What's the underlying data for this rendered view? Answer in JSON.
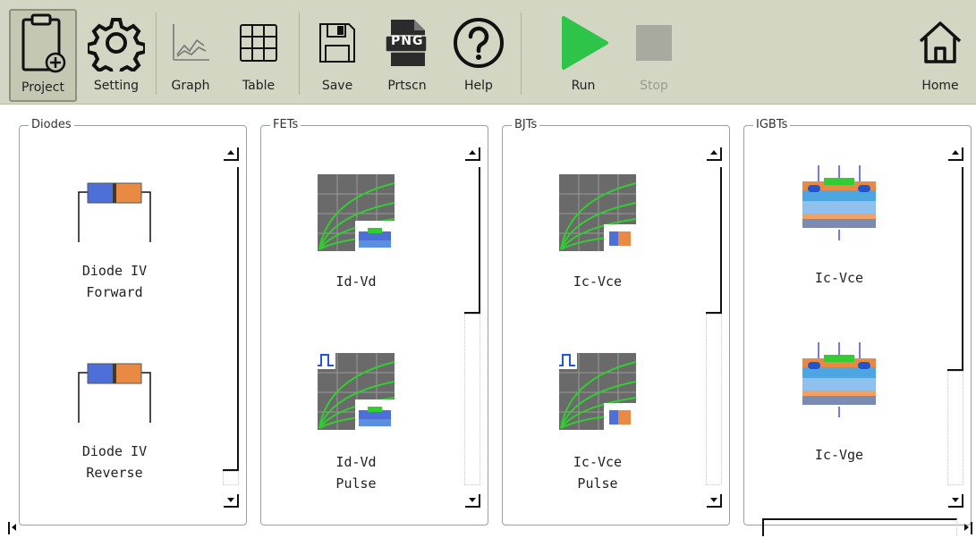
{
  "toolbar": {
    "project": "Project",
    "setting": "Setting",
    "graph": "Graph",
    "table": "Table",
    "save": "Save",
    "prtscn": "Prtscn",
    "png_badge": "PNG",
    "help": "Help",
    "run": "Run",
    "stop": "Stop",
    "home": "Home"
  },
  "groups": {
    "diodes": {
      "title": "Diodes",
      "items": [
        {
          "line1": "Diode IV",
          "line2": "Forward",
          "icon": "diode-icon"
        },
        {
          "line1": "Diode IV",
          "line2": "Reverse",
          "icon": "diode-icon"
        }
      ],
      "scroll_position": 0.0
    },
    "fets": {
      "title": "FETs",
      "items": [
        {
          "line1": "Id-Vd",
          "line2": "",
          "icon": "fet-curve-icon"
        },
        {
          "line1": "Id-Vd",
          "line2": "Pulse",
          "icon": "fet-pulse-curve-icon"
        }
      ],
      "scroll_position": 0.0
    },
    "bjts": {
      "title": "BJTs",
      "items": [
        {
          "line1": "Ic-Vce",
          "line2": "",
          "icon": "bjt-curve-icon"
        },
        {
          "line1": "Ic-Vce",
          "line2": "Pulse",
          "icon": "bjt-pulse-curve-icon"
        }
      ],
      "scroll_position": 0.0
    },
    "igbts": {
      "title": "IGBTs",
      "items": [
        {
          "line1": "Ic-Vce",
          "line2": "",
          "icon": "igbt-icon"
        },
        {
          "line1": "Ic-Vge",
          "line2": "",
          "icon": "igbt-icon"
        }
      ],
      "scroll_position": 0.0
    }
  },
  "colors": {
    "toolbar_bg": "#d2d6c2",
    "run_green": "#2ec44a",
    "stop_gray": "#a8aaa0",
    "curve_green": "#33cc33",
    "diode_blue": "#4d6fd8",
    "diode_orange": "#e98a44"
  }
}
